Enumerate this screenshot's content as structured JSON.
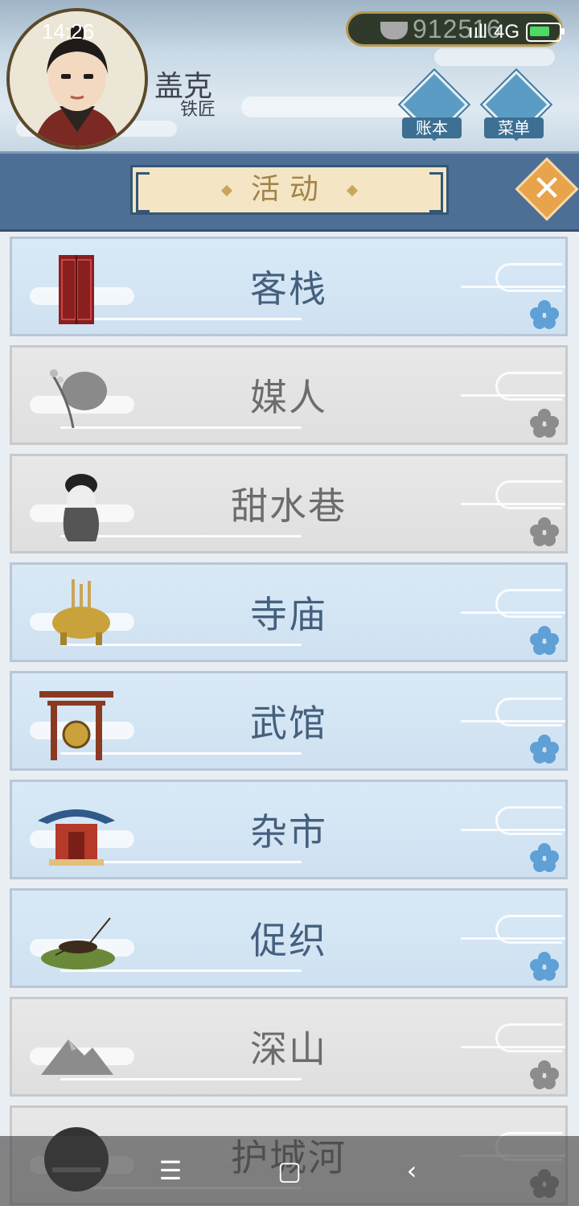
{
  "status_bar": {
    "time": "14:26",
    "network": "4G",
    "battery_level": 0.6
  },
  "currency": {
    "value": "912",
    "value_tail": "516"
  },
  "player": {
    "name": "盖克",
    "title": "铁匠"
  },
  "top_buttons": [
    {
      "label": "账本",
      "icon": "ledger-icon"
    },
    {
      "label": "菜单",
      "icon": "more-dots-icon"
    }
  ],
  "banner": {
    "title": "活动"
  },
  "locations": [
    {
      "label": "客栈",
      "icon": "inn-door-icon",
      "state": "active"
    },
    {
      "label": "媒人",
      "icon": "fan-umbrella-icon",
      "state": "locked"
    },
    {
      "label": "甜水巷",
      "icon": "lady-icon",
      "state": "locked"
    },
    {
      "label": "寺庙",
      "icon": "incense-burner-icon",
      "state": "active"
    },
    {
      "label": "武馆",
      "icon": "gong-gate-icon",
      "state": "active"
    },
    {
      "label": "杂市",
      "icon": "market-pavilion-icon",
      "state": "active"
    },
    {
      "label": "促织",
      "icon": "cricket-icon",
      "state": "active"
    },
    {
      "label": "深山",
      "icon": "mountain-icon",
      "state": "locked"
    },
    {
      "label": "护城河",
      "icon": "moat-icon",
      "state": "locked"
    }
  ],
  "colors": {
    "active_text": "#44607e",
    "locked_text": "#6c6c6c",
    "banner_bg": "#4d6f95",
    "accent_gold": "#c9a65a"
  },
  "nav": {
    "icons": [
      "menu-lines-icon",
      "home-square-icon",
      "back-chevron-icon"
    ]
  }
}
